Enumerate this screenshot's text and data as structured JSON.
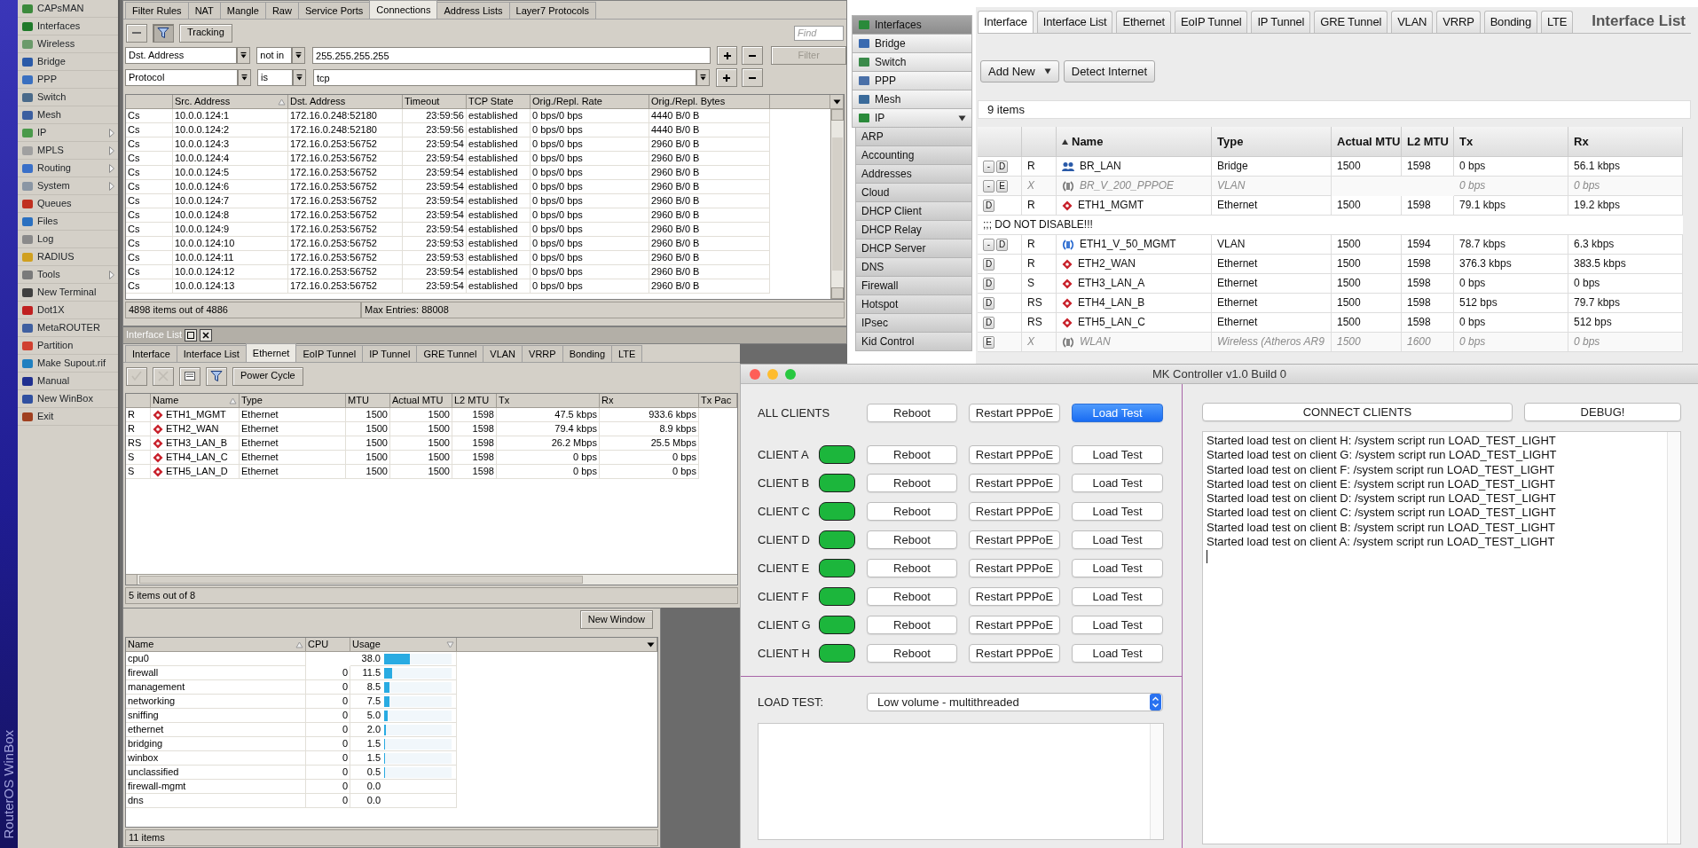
{
  "winbox": {
    "brand": "RouterOS WinBox",
    "menu": [
      {
        "label": "CAPsMAN",
        "submenu": false
      },
      {
        "label": "Interfaces",
        "submenu": false
      },
      {
        "label": "Wireless",
        "submenu": false
      },
      {
        "label": "Bridge",
        "submenu": false
      },
      {
        "label": "PPP",
        "submenu": false
      },
      {
        "label": "Switch",
        "submenu": false
      },
      {
        "label": "Mesh",
        "submenu": false
      },
      {
        "label": "IP",
        "submenu": true
      },
      {
        "label": "MPLS",
        "submenu": true
      },
      {
        "label": "Routing",
        "submenu": true
      },
      {
        "label": "System",
        "submenu": true
      },
      {
        "label": "Queues",
        "submenu": false
      },
      {
        "label": "Files",
        "submenu": false
      },
      {
        "label": "Log",
        "submenu": false
      },
      {
        "label": "RADIUS",
        "submenu": false
      },
      {
        "label": "Tools",
        "submenu": true
      },
      {
        "label": "New Terminal",
        "submenu": false
      },
      {
        "label": "Dot1X",
        "submenu": false
      },
      {
        "label": "MetaROUTER",
        "submenu": false
      },
      {
        "label": "Partition",
        "submenu": false
      },
      {
        "label": "Make Supout.rif",
        "submenu": false
      },
      {
        "label": "Manual",
        "submenu": false
      },
      {
        "label": "New WinBox",
        "submenu": false
      },
      {
        "label": "Exit",
        "submenu": false
      }
    ]
  },
  "firewall_window": {
    "tabs": [
      {
        "label": "Filter Rules",
        "selected": false
      },
      {
        "label": "NAT",
        "selected": false
      },
      {
        "label": "Mangle",
        "selected": false
      },
      {
        "label": "Raw",
        "selected": false
      },
      {
        "label": "Service Ports",
        "selected": false
      },
      {
        "label": "Connections",
        "selected": true
      },
      {
        "label": "Address Lists",
        "selected": false
      },
      {
        "label": "Layer7 Protocols",
        "selected": false
      }
    ],
    "toolbar": {
      "filter_on": true,
      "tracking": "Tracking",
      "find_placeholder": "Find"
    },
    "filters": [
      {
        "property": "Dst. Address",
        "operator": "not in",
        "value": "255.255.255.255",
        "value_dropdown": false
      },
      {
        "property": "Protocol",
        "operator": "is",
        "value": "tcp",
        "value_dropdown": true
      }
    ],
    "filter_button": {
      "label": "Filter",
      "disabled": true
    },
    "columns": [
      {
        "sorted": false
      },
      {
        "label": "Src. Address",
        "sorted": true,
        "descending": false
      },
      {
        "label": "Dst. Address",
        "sorted": false
      },
      {
        "label": "Timeout",
        "sorted": false
      },
      {
        "label": "TCP State",
        "sorted": false
      },
      {
        "label": "Orig./Repl. Rate",
        "sorted": false
      },
      {
        "label": "Orig./Repl. Bytes",
        "sorted": false
      }
    ],
    "rows": [
      [
        "Cs",
        "10.0.0.124:1",
        "172.16.0.248:52180",
        "23:59:56",
        "established",
        "0 bps/0 bps",
        "4440 B/0 B"
      ],
      [
        "Cs",
        "10.0.0.124:2",
        "172.16.0.248:52180",
        "23:59:56",
        "established",
        "0 bps/0 bps",
        "4440 B/0 B"
      ],
      [
        "Cs",
        "10.0.0.124:3",
        "172.16.0.253:56752",
        "23:59:54",
        "established",
        "0 bps/0 bps",
        "2960 B/0 B"
      ],
      [
        "Cs",
        "10.0.0.124:4",
        "172.16.0.253:56752",
        "23:59:54",
        "established",
        "0 bps/0 bps",
        "2960 B/0 B"
      ],
      [
        "Cs",
        "10.0.0.124:5",
        "172.16.0.253:56752",
        "23:59:54",
        "established",
        "0 bps/0 bps",
        "2960 B/0 B"
      ],
      [
        "Cs",
        "10.0.0.124:6",
        "172.16.0.253:56752",
        "23:59:54",
        "established",
        "0 bps/0 bps",
        "2960 B/0 B"
      ],
      [
        "Cs",
        "10.0.0.124:7",
        "172.16.0.253:56752",
        "23:59:54",
        "established",
        "0 bps/0 bps",
        "2960 B/0 B"
      ],
      [
        "Cs",
        "10.0.0.124:8",
        "172.16.0.253:56752",
        "23:59:54",
        "established",
        "0 bps/0 bps",
        "2960 B/0 B"
      ],
      [
        "Cs",
        "10.0.0.124:9",
        "172.16.0.253:56752",
        "23:59:54",
        "established",
        "0 bps/0 bps",
        "2960 B/0 B"
      ],
      [
        "Cs",
        "10.0.0.124:10",
        "172.16.0.253:56752",
        "23:59:53",
        "established",
        "0 bps/0 bps",
        "2960 B/0 B"
      ],
      [
        "Cs",
        "10.0.0.124:11",
        "172.16.0.253:56752",
        "23:59:53",
        "established",
        "0 bps/0 bps",
        "2960 B/0 B"
      ],
      [
        "Cs",
        "10.0.0.124:12",
        "172.16.0.253:56752",
        "23:59:54",
        "established",
        "0 bps/0 bps",
        "2960 B/0 B"
      ],
      [
        "Cs",
        "10.0.0.124:13",
        "172.16.0.253:56752",
        "23:59:54",
        "established",
        "0 bps/0 bps",
        "2960 B/0 B"
      ]
    ],
    "status": [
      "4898 items out of 4886",
      "Max Entries: 88008"
    ]
  },
  "interface_window": {
    "title": "Interface List",
    "tabs": [
      {
        "label": "Interface",
        "selected": false
      },
      {
        "label": "Interface List",
        "selected": false
      },
      {
        "label": "Ethernet",
        "selected": true
      },
      {
        "label": "EoIP Tunnel",
        "selected": false
      },
      {
        "label": "IP Tunnel",
        "selected": false
      },
      {
        "label": "GRE Tunnel",
        "selected": false
      },
      {
        "label": "VLAN",
        "selected": false
      },
      {
        "label": "VRRP",
        "selected": false
      },
      {
        "label": "Bonding",
        "selected": false
      },
      {
        "label": "LTE",
        "selected": false
      }
    ],
    "toolbar": [
      {
        "kind": "enable",
        "disabled": true
      },
      {
        "kind": "disable",
        "disabled": true
      },
      {
        "kind": "comment",
        "disabled": false
      },
      {
        "kind": "filter",
        "disabled": false
      },
      {
        "kind": "text",
        "label": "Power Cycle",
        "disabled": false
      }
    ],
    "columns": [
      {
        "sorted": false
      },
      {
        "label": "Name",
        "sorted": true,
        "descending": false
      },
      {
        "label": "Type",
        "sorted": false
      },
      {
        "label": "MTU",
        "sorted": false
      },
      {
        "label": "Actual MTU",
        "sorted": false
      },
      {
        "label": "L2 MTU",
        "sorted": false
      },
      {
        "label": "Tx",
        "sorted": false
      },
      {
        "label": "Rx",
        "sorted": false
      },
      {
        "label": "Tx Pac",
        "sorted": false
      }
    ],
    "rows": [
      {
        "flags": "R",
        "name": "ETH1_MGMT",
        "type": "Ethernet",
        "mtu": "1500",
        "actual_mtu": "1500",
        "l2_mtu": "1598",
        "tx": "47.5 kbps",
        "rx": "933.6 kbps"
      },
      {
        "flags": "R",
        "name": "ETH2_WAN",
        "type": "Ethernet",
        "mtu": "1500",
        "actual_mtu": "1500",
        "l2_mtu": "1598",
        "tx": "79.4 kbps",
        "rx": "8.9 kbps"
      },
      {
        "flags": "RS",
        "name": "ETH3_LAN_B",
        "type": "Ethernet",
        "mtu": "1500",
        "actual_mtu": "1500",
        "l2_mtu": "1598",
        "tx": "26.2 Mbps",
        "rx": "25.5 Mbps"
      },
      {
        "flags": "S",
        "name": "ETH4_LAN_C",
        "type": "Ethernet",
        "mtu": "1500",
        "actual_mtu": "1500",
        "l2_mtu": "1598",
        "tx": "0 bps",
        "rx": "0 bps"
      },
      {
        "flags": "S",
        "name": "ETH5_LAN_D",
        "type": "Ethernet",
        "mtu": "1500",
        "actual_mtu": "1500",
        "l2_mtu": "1598",
        "tx": "0 bps",
        "rx": "0 bps"
      }
    ],
    "status": "5 items out of 8"
  },
  "cpu_window": {
    "new_window": "New Window",
    "columns": [
      {
        "label": "Name",
        "sorted": true,
        "descending": false
      },
      {
        "label": "CPU",
        "sorted": false
      },
      {
        "label": "Usage",
        "sorted": true,
        "descending": true
      }
    ],
    "rows": [
      {
        "name": "cpu0",
        "usage": "38.0",
        "level": 0.38
      },
      {
        "name": "firewall",
        "cpu": "0",
        "usage": "11.5",
        "level": 0.115
      },
      {
        "name": "management",
        "cpu": "0",
        "usage": "8.5",
        "level": 0.085
      },
      {
        "name": "networking",
        "cpu": "0",
        "usage": "7.5",
        "level": 0.075
      },
      {
        "name": "sniffing",
        "cpu": "0",
        "usage": "5.0",
        "level": 0.05
      },
      {
        "name": "ethernet",
        "cpu": "0",
        "usage": "2.0",
        "level": 0.02
      },
      {
        "name": "bridging",
        "cpu": "0",
        "usage": "1.5",
        "level": 0.015
      },
      {
        "name": "winbox",
        "cpu": "0",
        "usage": "1.5",
        "level": 0.015
      },
      {
        "name": "unclassified",
        "cpu": "0",
        "usage": "0.5",
        "level": 0.005
      },
      {
        "name": "firewall-mgmt",
        "cpu": "0",
        "usage": "0.0"
      },
      {
        "name": "dns",
        "cpu": "0",
        "usage": "0.0"
      }
    ],
    "status": "11 items"
  },
  "webfig": {
    "menu": [
      {
        "label": "Interfaces",
        "selected": true
      },
      {
        "label": "Bridge",
        "selected": false
      },
      {
        "label": "Switch",
        "selected": false
      },
      {
        "label": "PPP",
        "selected": false
      },
      {
        "label": "Mesh",
        "selected": false
      },
      {
        "label": "IP",
        "selected": false,
        "expanded": true,
        "children": [
          {
            "label": "ARP",
            "selected": false
          },
          {
            "label": "Accounting",
            "selected": false
          },
          {
            "label": "Addresses",
            "selected": false
          },
          {
            "label": "Cloud",
            "selected": false
          },
          {
            "label": "DHCP Client",
            "selected": false
          },
          {
            "label": "DHCP Relay",
            "selected": false
          },
          {
            "label": "DHCP Server",
            "selected": false
          },
          {
            "label": "DNS",
            "selected": false
          },
          {
            "label": "Firewall",
            "selected": false
          },
          {
            "label": "Hotspot",
            "selected": false
          },
          {
            "label": "IPsec",
            "selected": false
          },
          {
            "label": "Kid Control",
            "selected": false
          }
        ]
      }
    ],
    "tabs": [
      {
        "label": "Interface",
        "selected": true
      },
      {
        "label": "Interface List",
        "selected": false
      },
      {
        "label": "Ethernet",
        "selected": false
      },
      {
        "label": "EoIP Tunnel",
        "selected": false
      },
      {
        "label": "IP Tunnel",
        "selected": false
      },
      {
        "label": "GRE Tunnel",
        "selected": false
      },
      {
        "label": "VLAN",
        "selected": false
      },
      {
        "label": "VRRP",
        "selected": false
      },
      {
        "label": "Bonding",
        "selected": false
      },
      {
        "label": "LTE",
        "selected": false
      }
    ],
    "title": "Interface List",
    "buttons": [
      {
        "label": "Add New",
        "dropdown": true
      },
      {
        "label": "Detect Internet",
        "dropdown": false
      }
    ],
    "count": "9 items",
    "columns": [
      {
        "label": "Name",
        "sorted": true,
        "descending": false
      },
      {
        "label": "Type",
        "sorted": false
      },
      {
        "label": "Actual MTU",
        "sorted": false
      },
      {
        "label": "L2 MTU",
        "sorted": false
      },
      {
        "label": "Tx",
        "sorted": false
      },
      {
        "label": "Rx",
        "sorted": false
      }
    ],
    "rows": [
      {
        "kind": "bridge",
        "buttons": [
          "-",
          "D"
        ],
        "flags": "R",
        "name": "BR_LAN",
        "type": "Bridge",
        "actual_mtu": "1500",
        "l2_mtu": "1598",
        "tx": "0 bps",
        "rx": "56.1 kbps",
        "disabled": false
      },
      {
        "kind": "vlan",
        "buttons": [
          "-",
          "E"
        ],
        "flags": "X",
        "name": "BR_V_200_PPPOE",
        "type": "VLAN",
        "tx": "0 bps",
        "rx": "0 bps",
        "disabled": true
      },
      {
        "kind": "ethernet",
        "buttons": [
          "D"
        ],
        "flags": "R",
        "name": "ETH1_MGMT",
        "type": "Ethernet",
        "actual_mtu": "1500",
        "l2_mtu": "1598",
        "tx": "79.1 kbps",
        "rx": "19.2 kbps",
        "disabled": false
      },
      {
        "kind": "comment",
        "text": ";;; DO NOT DISABLE!!!"
      },
      {
        "kind": "vlan",
        "buttons": [
          "-",
          "D"
        ],
        "flags": "R",
        "name": "ETH1_V_50_MGMT",
        "type": "VLAN",
        "actual_mtu": "1500",
        "l2_mtu": "1594",
        "tx": "78.7 kbps",
        "rx": "6.3 kbps",
        "disabled": false
      },
      {
        "kind": "ethernet",
        "buttons": [
          "D"
        ],
        "flags": "R",
        "name": "ETH2_WAN",
        "type": "Ethernet",
        "actual_mtu": "1500",
        "l2_mtu": "1598",
        "tx": "376.3 kbps",
        "rx": "383.5 kbps",
        "disabled": false
      },
      {
        "kind": "ethernet",
        "buttons": [
          "D"
        ],
        "flags": "S",
        "name": "ETH3_LAN_A",
        "type": "Ethernet",
        "actual_mtu": "1500",
        "l2_mtu": "1598",
        "tx": "0 bps",
        "rx": "0 bps",
        "disabled": false
      },
      {
        "kind": "ethernet",
        "buttons": [
          "D"
        ],
        "flags": "RS",
        "name": "ETH4_LAN_B",
        "type": "Ethernet",
        "actual_mtu": "1500",
        "l2_mtu": "1598",
        "tx": "512 bps",
        "rx": "79.7 kbps",
        "disabled": false
      },
      {
        "kind": "ethernet",
        "buttons": [
          "D"
        ],
        "flags": "RS",
        "name": "ETH5_LAN_C",
        "type": "Ethernet",
        "actual_mtu": "1500",
        "l2_mtu": "1598",
        "tx": "0 bps",
        "rx": "512 bps",
        "disabled": false
      },
      {
        "kind": "wireless",
        "buttons": [
          "E"
        ],
        "flags": "X",
        "name": "WLAN",
        "type": "Wireless (Atheros AR9",
        "actual_mtu": "1500",
        "l2_mtu": "1600",
        "tx": "0 bps",
        "rx": "0 bps",
        "disabled": true
      }
    ]
  },
  "mk_controller": {
    "title": "MK Controller v1.0 Build 0",
    "all_clients": {
      "label": "ALL CLIENTS",
      "buttons": [
        {
          "label": "Reboot",
          "default": false
        },
        {
          "label": "Restart PPPoE",
          "default": false
        },
        {
          "label": "Load Test",
          "default": true
        }
      ]
    },
    "clients": [
      {
        "label": "CLIENT A",
        "online": true,
        "buttons": [
          "Reboot",
          "Restart PPPoE",
          "Load Test"
        ]
      },
      {
        "label": "CLIENT B",
        "online": true,
        "buttons": [
          "Reboot",
          "Restart PPPoE",
          "Load Test"
        ]
      },
      {
        "label": "CLIENT C",
        "online": true,
        "buttons": [
          "Reboot",
          "Restart PPPoE",
          "Load Test"
        ]
      },
      {
        "label": "CLIENT D",
        "online": true,
        "buttons": [
          "Reboot",
          "Restart PPPoE",
          "Load Test"
        ]
      },
      {
        "label": "CLIENT E",
        "online": true,
        "buttons": [
          "Reboot",
          "Restart PPPoE",
          "Load Test"
        ]
      },
      {
        "label": "CLIENT F",
        "online": true,
        "buttons": [
          "Reboot",
          "Restart PPPoE",
          "Load Test"
        ]
      },
      {
        "label": "CLIENT G",
        "online": true,
        "buttons": [
          "Reboot",
          "Restart PPPoE",
          "Load Test"
        ]
      },
      {
        "label": "CLIENT H",
        "online": true,
        "buttons": [
          "Reboot",
          "Restart PPPoE",
          "Load Test"
        ]
      }
    ],
    "load_test": {
      "label": "LOAD TEST:",
      "value": "Low volume - multithreaded"
    },
    "connect_button": "CONNECT CLIENTS",
    "debug_button": "DEBUG!",
    "log": [
      "Started load test on client H: /system script run LOAD_TEST_LIGHT",
      "Started load test on client G: /system script run LOAD_TEST_LIGHT",
      "Started load test on client F: /system script run LOAD_TEST_LIGHT",
      "Started load test on client E: /system script run LOAD_TEST_LIGHT",
      "Started load test on client D: /system script run LOAD_TEST_LIGHT",
      "Started load test on client C: /system script run LOAD_TEST_LIGHT",
      "Started load test on client B: /system script run LOAD_TEST_LIGHT",
      "Started load test on client A: /system script run LOAD_TEST_LIGHT"
    ]
  }
}
